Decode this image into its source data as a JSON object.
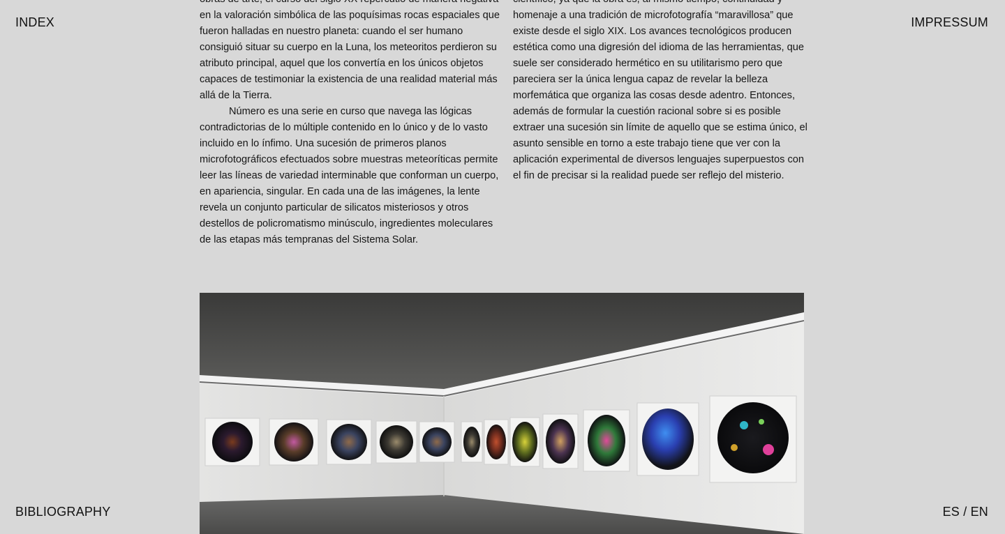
{
  "nav": {
    "index": "INDEX",
    "impressum": "IMPRESSUM",
    "bibliography": "BIBLIOGRAPHY",
    "language": "ES / EN"
  },
  "text": {
    "left_p1": "obras de arte, el curso del siglo XX repercutió de manera negativa en la valoración simbólica de las poquísimas rocas espaciales que fueron halladas en nuestro planeta: cuando el ser humano consiguió situar su cuerpo en la Luna, los meteoritos perdieron su atributo principal, aquel que los convertía en los únicos objetos capaces de testimoniar la existencia de una realidad material más allá de la Tierra.",
    "left_p2": "Número es una serie en curso que navega las lógicas contradictorias de lo múltiple contenido en lo único y de lo vasto incluido en lo ínfimo. Una sucesión de primeros planos microfotográficos efectuados sobre muestras meteoríticas permite leer las líneas de variedad interminable que conforman un cuerpo, en apariencia, singular. En cada una de las imágenes, la lente revela un conjunto particular de silicatos misteriosos y otros destellos de policromatismo minúsculo, ingredientes moleculares de las etapas más tempranas del Sistema Solar.",
    "right_p1": "científico, ya que la obra es, al mismo tiempo, continuidad y homenaje a una tradición de microfotografía “maravillosa” que existe desde el siglo XIX. Los avances tecnológicos producen estética como una digresión del idioma de las herramientas, que suele ser considerado hermético en su utilitarismo pero que pareciera ser la única lengua capaz de revelar la belleza morfemática que organiza las cosas desde adentro. Entonces, además de formular la cuestión racional sobre si es posible extraer una sucesión sin límite de aquello que se estima único, el asunto sensible en torno a este trabajo tiene que ver con la aplicación experimental de diversos lenguajes superpuestos con el fin de precisar si la realidad puede ser reflejo del misterio."
  },
  "colors": {
    "background": "#d8d8d8",
    "text": "#111111"
  }
}
